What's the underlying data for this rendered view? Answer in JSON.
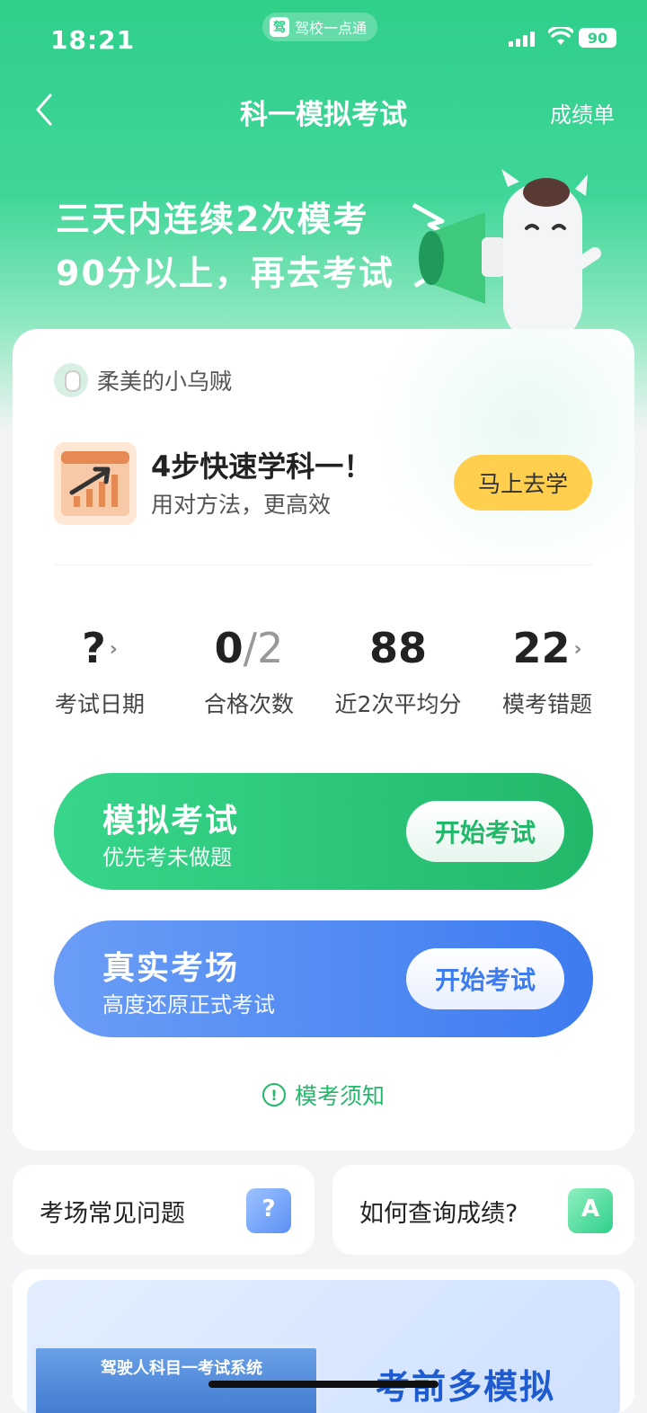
{
  "status_bar": {
    "time": "18:21",
    "app_name": "驾校一点通",
    "app_logo_char": "驾",
    "battery": "90"
  },
  "nav": {
    "title": "科一模拟考试",
    "right_link": "成绩单"
  },
  "hero": {
    "line1": "三天内连续2次模考",
    "line2": "90分以上，再去考试"
  },
  "user": {
    "name": "柔美的小乌贼"
  },
  "promo": {
    "title": "4步快速学科一！",
    "subtitle": "用对方法，更高效",
    "button": "马上去学"
  },
  "stats": [
    {
      "value": "?",
      "value_dim": "",
      "label": "考试日期",
      "arrow": "›"
    },
    {
      "value": "0",
      "value_dim": "/2",
      "label": "合格次数",
      "arrow": ""
    },
    {
      "value": "88",
      "value_dim": "",
      "label": "近2次平均分",
      "arrow": ""
    },
    {
      "value": "22",
      "value_dim": "",
      "label": "模考错题",
      "arrow": "›"
    }
  ],
  "exams": [
    {
      "title": "模拟考试",
      "subtitle": "优先考未做题",
      "button": "开始考试"
    },
    {
      "title": "真实考场",
      "subtitle": "高度还原正式考试",
      "button": "开始考试"
    }
  ],
  "notice": {
    "icon": "!",
    "label": "模考须知"
  },
  "faq": [
    {
      "label": "考场常见问题",
      "icon": "?"
    },
    {
      "label": "如何查询成绩?",
      "icon": "A"
    }
  ],
  "banner": {
    "screen_text": "驾驶人科目一考试系统",
    "title": "考前多模拟"
  },
  "colors": {
    "brand_green": "#22b86a",
    "accent_blue": "#3d7bf0",
    "cta_yellow": "#ffcf4d"
  }
}
